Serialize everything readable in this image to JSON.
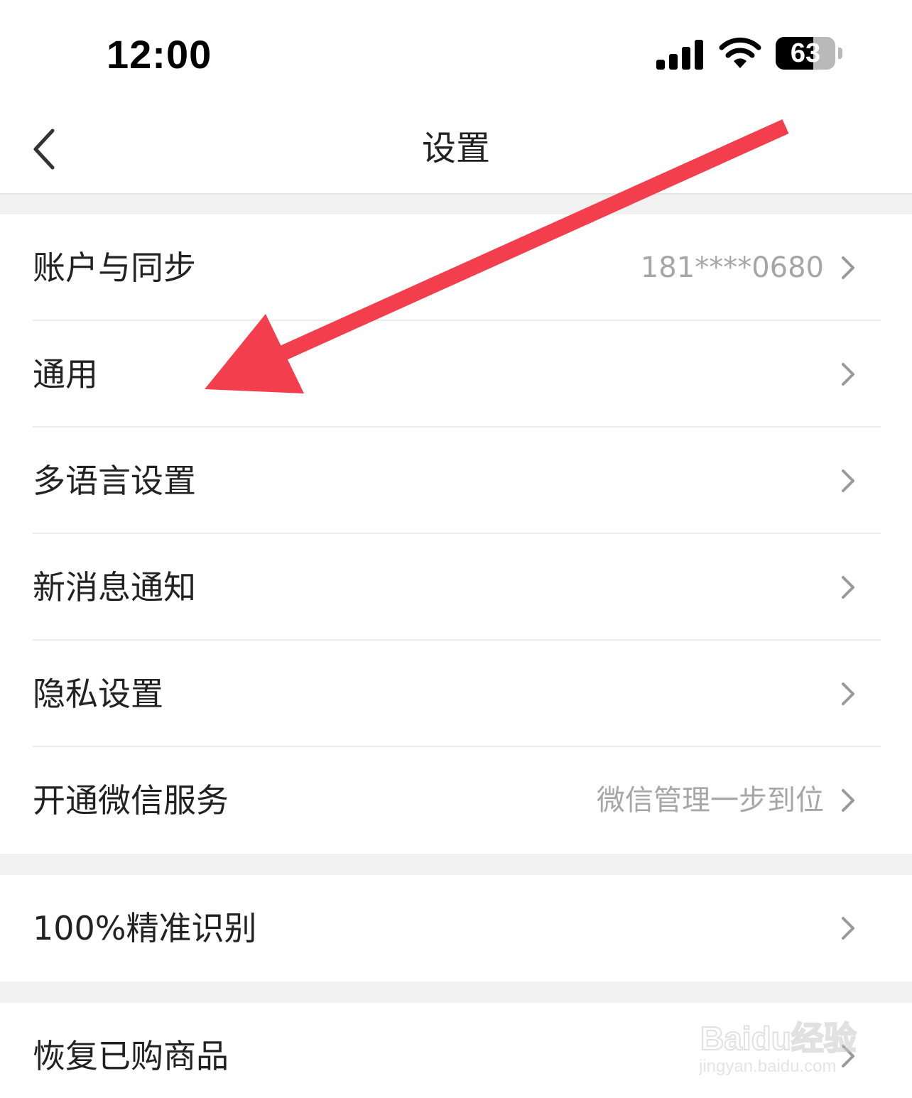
{
  "status_bar": {
    "time": "12:00",
    "battery_level": "63",
    "battery_fraction": 0.63,
    "icons": [
      "signal-icon",
      "wifi-icon",
      "battery-icon"
    ]
  },
  "nav": {
    "title": "设置",
    "back_icon": "chevron-left-icon"
  },
  "groups": [
    {
      "items": [
        {
          "label": "账户与同步",
          "value": "181****0680"
        },
        {
          "label": "通用",
          "value": ""
        },
        {
          "label": "多语言设置",
          "value": ""
        },
        {
          "label": "新消息通知",
          "value": ""
        },
        {
          "label": "隐私设置",
          "value": ""
        },
        {
          "label": "开通微信服务",
          "value": "微信管理一步到位"
        }
      ]
    },
    {
      "items": [
        {
          "label": "100%精准识别",
          "value": ""
        }
      ]
    },
    {
      "items": [
        {
          "label": "恢复已购商品",
          "value": ""
        }
      ]
    }
  ],
  "row_icon": "chevron-right-icon",
  "annotation": {
    "type": "red-arrow",
    "color": "#f33f4d",
    "points_to": "通用"
  },
  "watermark": {
    "brand": "Baidu经验",
    "url": "jingyan.baidu.com"
  },
  "colors": {
    "background": "#ffffff",
    "separator": "#f1f1f1",
    "label": "#222222",
    "secondary": "#a6a6a6",
    "arrow": "#f33f4d"
  }
}
